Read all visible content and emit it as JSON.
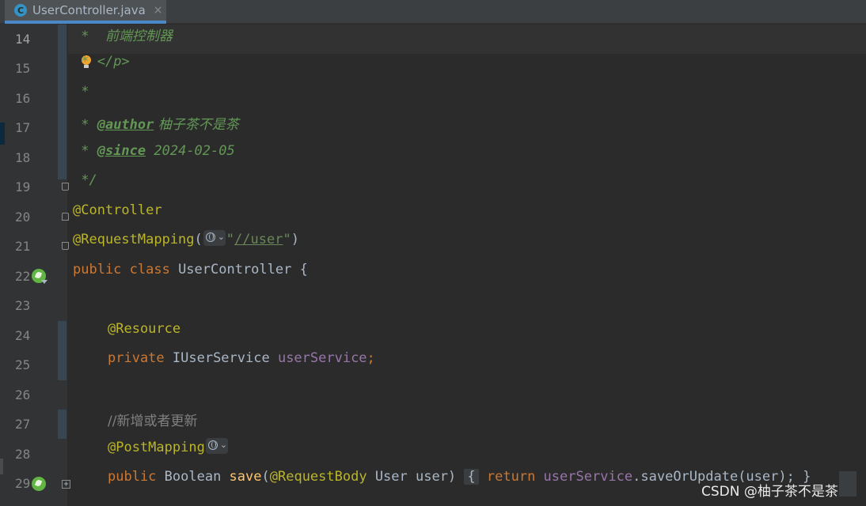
{
  "tab": {
    "icon": "class-c-icon",
    "label": "UserController.java",
    "close": "×"
  },
  "lines": [
    {
      "num": "14",
      "current": true
    },
    {
      "num": "15"
    },
    {
      "num": "16"
    },
    {
      "num": "17"
    },
    {
      "num": "18"
    },
    {
      "num": "19"
    },
    {
      "num": "20"
    },
    {
      "num": "21"
    },
    {
      "num": "22"
    },
    {
      "num": "23"
    },
    {
      "num": "24"
    },
    {
      "num": "25"
    },
    {
      "num": "26"
    },
    {
      "num": "27"
    },
    {
      "num": "28"
    },
    {
      "num": "29"
    }
  ],
  "code": {
    "l14": {
      "star": " *  ",
      "text": "前端控制器"
    },
    "l15": {
      "star": " * ",
      "text": "</p>"
    },
    "l16": {
      "star": " *"
    },
    "l17": {
      "star": " * ",
      "tag": "@author",
      "text": " 柚子茶不是茶"
    },
    "l18": {
      "star": " * ",
      "tag": "@since",
      "text": " 2024-02-05"
    },
    "l19": {
      "text": " */"
    },
    "l20": {
      "ann": "@Controller"
    },
    "l21": {
      "ann": "@RequestMapping",
      "open": "(",
      "quote1": "\"",
      "path": "//user",
      "quote2": "\"",
      "close": ")"
    },
    "l22": {
      "kw": "public class ",
      "name": "UserController",
      "brace": " {"
    },
    "l24": {
      "ann": "@Resource"
    },
    "l25": {
      "kw": "private ",
      "type": "IUserService ",
      "field": "userService",
      "semi": ";"
    },
    "l27": {
      "comment": "//新增或者更新"
    },
    "l28": {
      "ann": "@PostMapping"
    },
    "l29": {
      "kw": "public ",
      "type": "Boolean ",
      "fn": "save",
      "open": "(",
      "ann": "@RequestBody",
      "params": " User user) ",
      "fold": "{",
      "ret": " return ",
      "field": "userService",
      "dot": ".saveOrUpdate(user); }"
    }
  },
  "watermark": "CSDN @柚子茶不是茶",
  "colors": {
    "background": "#2b2b2b",
    "gutter": "#313335",
    "comment": "#629755",
    "annotation": "#bbb529",
    "keyword": "#cc7832",
    "field": "#9876aa",
    "function": "#ffc66d",
    "string": "#6a8759",
    "text": "#a9b7c6"
  }
}
